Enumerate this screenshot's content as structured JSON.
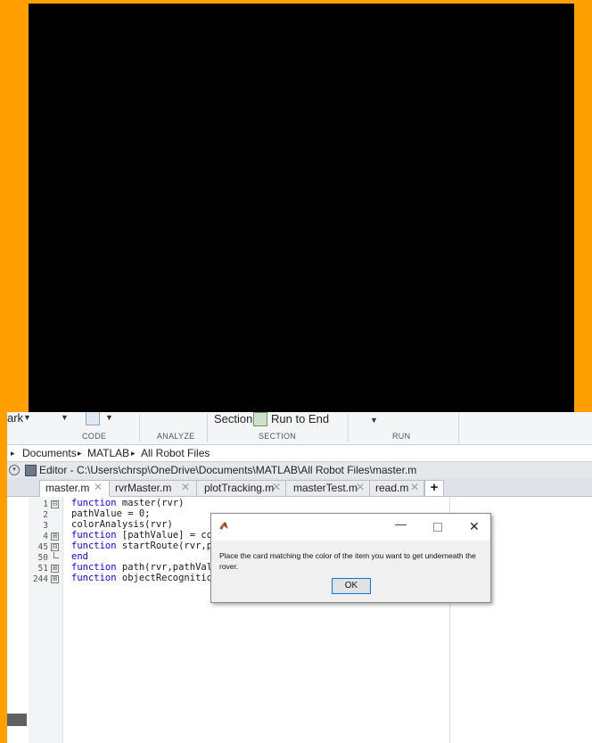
{
  "toolstrip": {
    "partial_left_label": "ark",
    "section_label": "Section",
    "run_to_end_label": "Run to End",
    "groups": [
      "CODE",
      "ANALYZE",
      "SECTION",
      "RUN"
    ]
  },
  "breadcrumb": {
    "items": [
      "Documents",
      "MATLAB",
      "All Robot Files"
    ],
    "separator": "▸"
  },
  "editor": {
    "title": "Editor - C:\\Users\\chrsp\\OneDrive\\Documents\\MATLAB\\All Robot Files\\master.m"
  },
  "tabs": [
    {
      "label": "master.m"
    },
    {
      "label": "rvrMaster.m"
    },
    {
      "label": "plotTracking.m"
    },
    {
      "label": "masterTest.m"
    },
    {
      "label": "read.m"
    }
  ],
  "tab_add_label": "+",
  "code_lines": [
    {
      "num": "1",
      "fold": "⊟",
      "kw": "function",
      "rest": " master(rvr)"
    },
    {
      "num": "2",
      "fold": "",
      "kw": "",
      "rest": "pathValue = 0;"
    },
    {
      "num": "3",
      "fold": "",
      "kw": "",
      "rest": "colorAnalysis(rvr)"
    },
    {
      "num": "4",
      "fold": "⊞",
      "kw": "function",
      "rest": " [pathValue] = colo"
    },
    {
      "num": "45",
      "fold": "⊟",
      "kw": "function",
      "rest": " startRoute(rvr,pat"
    },
    {
      "num": "50",
      "fold": "└",
      "kw": "end",
      "rest": ""
    },
    {
      "num": "51",
      "fold": "⊞",
      "kw": "function",
      "rest": " path(rvr,pathValue"
    },
    {
      "num": "244",
      "fold": "⊞",
      "kw": "function",
      "rest": " objectRecognition("
    }
  ],
  "dialog": {
    "title_icon": "matlab-logo-icon",
    "message": "Place the card matching the color of the item you want to get underneath the rover.",
    "ok_label": "OK",
    "minimize_glyph": "—",
    "close_glyph": "✕"
  },
  "colors": {
    "frame": "#ff9f00",
    "keyword": "#0e00ff",
    "dialog_button_border": "#0078d7"
  }
}
